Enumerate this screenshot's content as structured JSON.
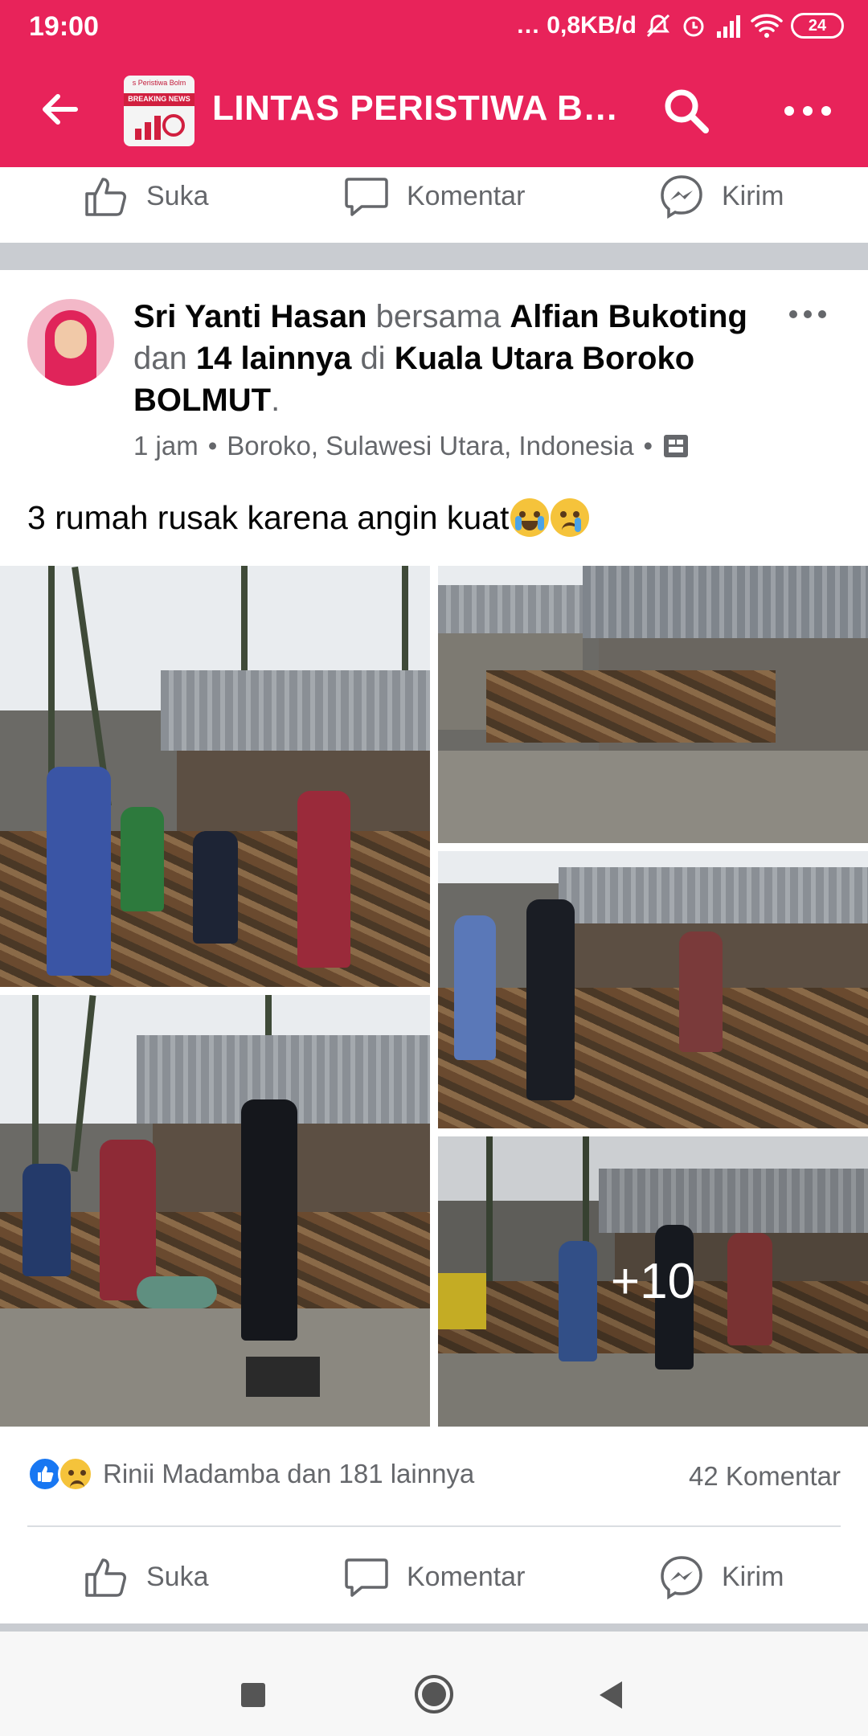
{
  "status_bar": {
    "time": "19:00",
    "network_speed": "… 0,8KB/d",
    "battery": "24",
    "icons": [
      "mute-icon",
      "alarm-icon",
      "signal-icon",
      "wifi-icon",
      "battery-icon"
    ]
  },
  "app_bar": {
    "title": "LINTAS PERISTIWA B…",
    "logo_text": "s Peristiwa Bolm",
    "logo_sub": "BREAKING NEWS",
    "accent_color": "#e8235a"
  },
  "top_actions": {
    "like": "Suka",
    "comment": "Komentar",
    "send": "Kirim"
  },
  "post": {
    "author": "Sri Yanti Hasan",
    "with_word": "bersama",
    "tagged": "Alfian Bukoting",
    "and_word": "dan",
    "others": "14 lainnya",
    "at_word": "di",
    "place": "Kuala Utara Boroko BOLMUT",
    "period": ".",
    "time": "1 jam",
    "separator": "•",
    "location": "Boroko, Sulawesi Utara, Indonesia",
    "text": "3 rumah rusak karena angin kuat",
    "more_photos": "+10",
    "reactions": "Rinii Madamba dan 181 lainnya",
    "comments": "42 Komentar"
  },
  "bottom_actions": {
    "like": "Suka",
    "comment": "Komentar",
    "send": "Kirim"
  }
}
